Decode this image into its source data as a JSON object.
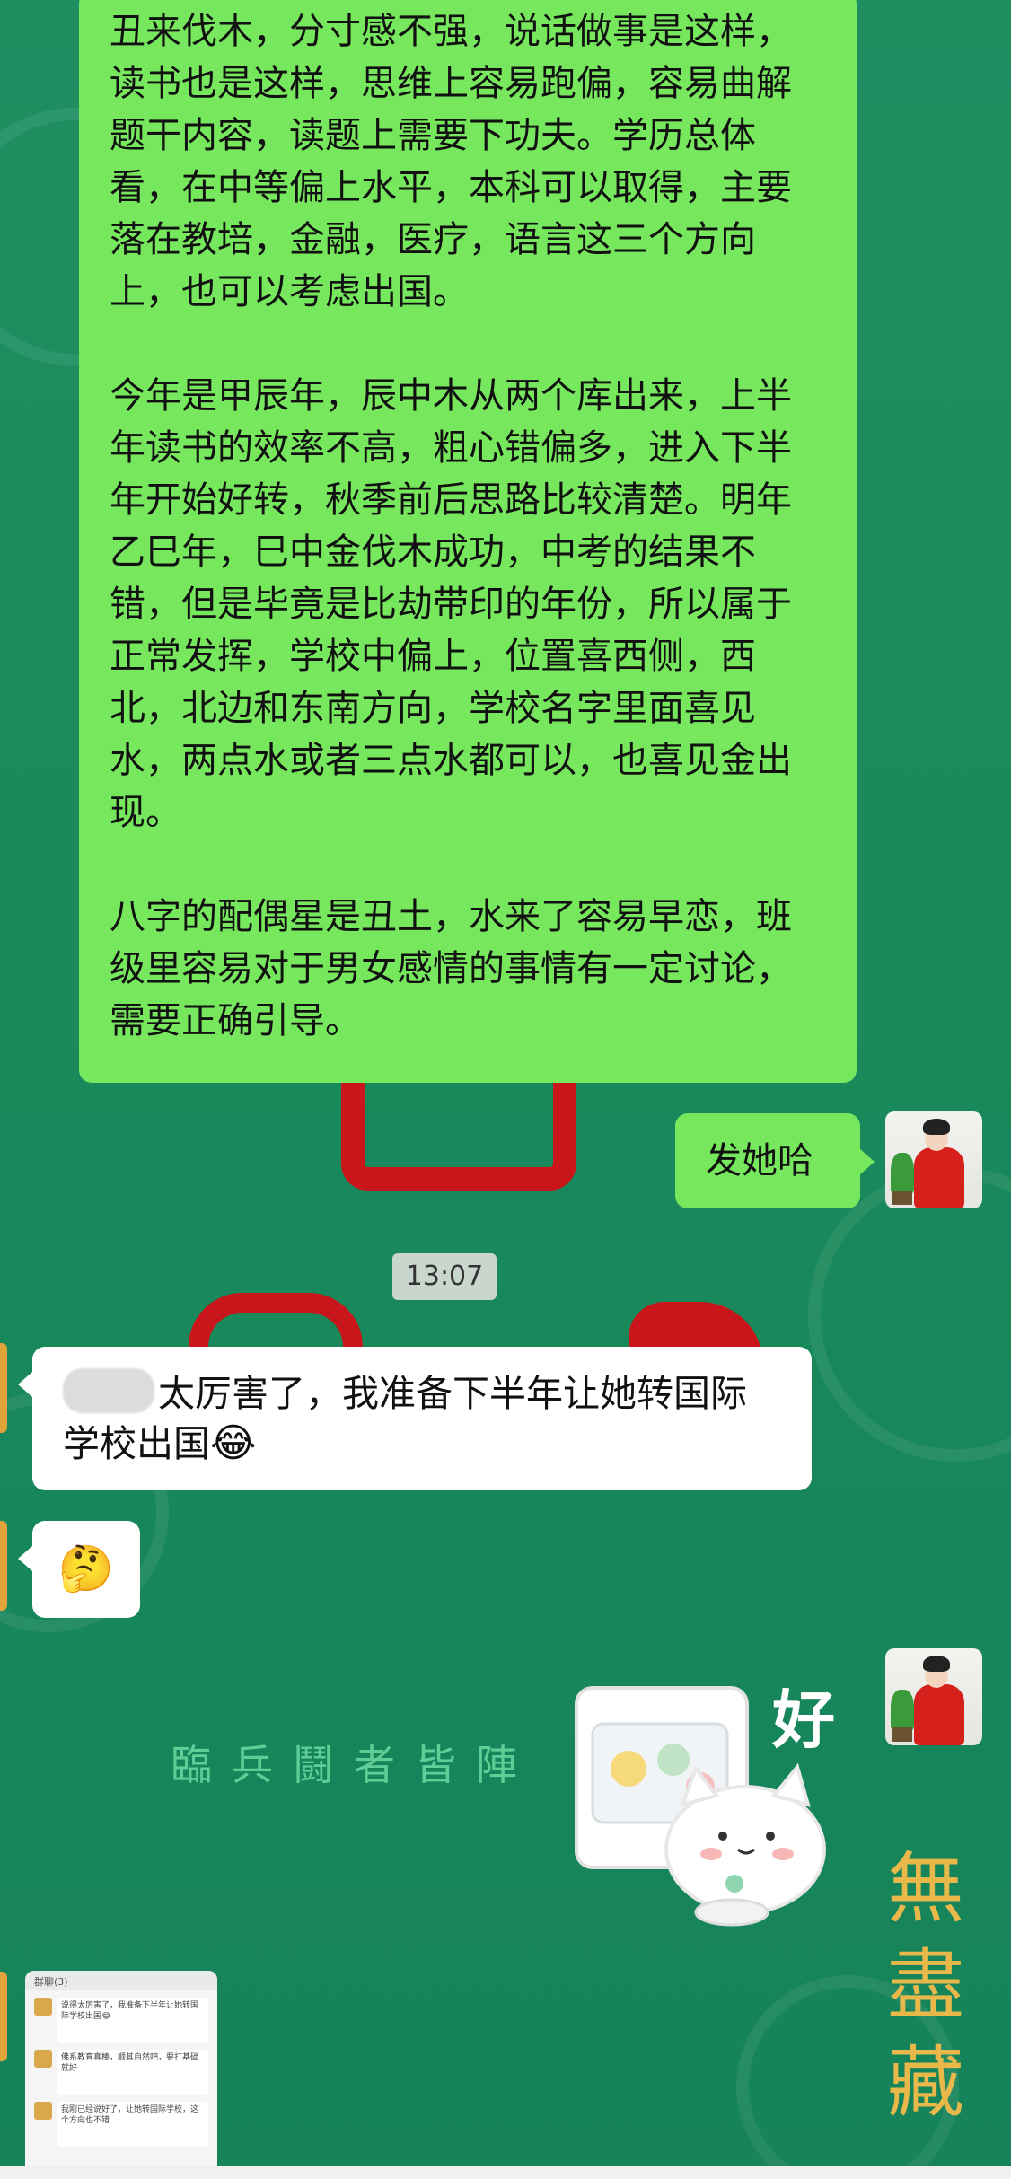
{
  "messages": {
    "reading_paragraph": "丑来伐木，分寸感不强，说话做事是这样，读书也是这样，思维上容易跑偏，容易曲解题干内容，读题上需要下功夫。学历总体看，在中等偏上水平，本科可以取得，主要落在教培，金融，医疗，语言这三个方向上，也可以考虑出国。",
    "year_paragraph": "今年是甲辰年，辰中木从两个库出来，上半年读书的效率不高，粗心错偏多，进入下半年开始好转，秋季前后思路比较清楚。明年乙巳年，巳中金伐木成功，中考的结果不错，但是毕竟是比劫带印的年份，所以属于正常发挥，学校中偏上，位置喜西侧，西北，北边和东南方向，学校名字里面喜见水，两点水或者三点水都可以，也喜见金出现。",
    "spouse_paragraph": "八字的配偶星是丑土，水来了容易早恋，班级里容易对于男女感情的事情有一定讨论，需要正确引导。",
    "send_her": "发她哈",
    "timestamp": "13:07",
    "reply_text": "太厉害了，我准备下半年让她转国际学校出国",
    "reply_emoji": "😂",
    "thinking_emoji": "🤔",
    "sticker_text": "好"
  },
  "wallpaper": {
    "chars": "臨兵鬪者皆陣",
    "gold_chars": "無盡藏"
  },
  "thumbnail": {
    "title": "群聊(3)",
    "line1": "说得太厉害了，我准备下半年让她转国际学校出国😂",
    "line2": "佛系教育真棒，顺其自然吧，要打基础就好",
    "line3": "我刚已经说好了，让她转国际学校，这个方向也不错"
  },
  "colors": {
    "bg": "#1a8a5c",
    "outgoing_bubble": "#77e85d",
    "incoming_bubble": "#ffffff"
  }
}
